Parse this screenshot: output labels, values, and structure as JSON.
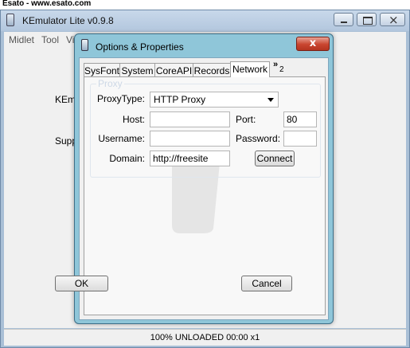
{
  "watermark": {
    "text": "Esato - www.esato.com"
  },
  "main_window": {
    "title": "KEmulator Lite v0.9.8",
    "menu": [
      "Midlet",
      "Tool",
      "Vi"
    ],
    "background_text": [
      "KEmu",
      "Supp"
    ],
    "status": "100% UNLOADED 00:00 x1"
  },
  "dialog": {
    "title": "Options & Properties",
    "close_label": "x",
    "tabs": [
      {
        "label": "SysFont",
        "active": false
      },
      {
        "label": "System",
        "active": false
      },
      {
        "label": "CoreAPI",
        "active": false
      },
      {
        "label": "Records",
        "active": false
      },
      {
        "label": "Network",
        "active": true
      }
    ],
    "more_tabs": {
      "chevron": "»",
      "count": "2"
    },
    "proxy": {
      "group_label": "Proxy",
      "proxy_type_label": "ProxyType:",
      "proxy_type_value": "HTTP Proxy",
      "host_label": "Host:",
      "host_value": "",
      "port_label": "Port:",
      "port_value": "80",
      "username_label": "Username:",
      "username_value": "",
      "password_label": "Password:",
      "password_value": "",
      "domain_label": "Domain:",
      "domain_value": "http://freesite",
      "connect_label": "Connect"
    },
    "ok_label": "OK",
    "cancel_label": "Cancel"
  },
  "colors": {
    "dialog_frame": "#8fc6d9",
    "close_button": "#c9452f",
    "window_frame": "#a9bfd6"
  }
}
